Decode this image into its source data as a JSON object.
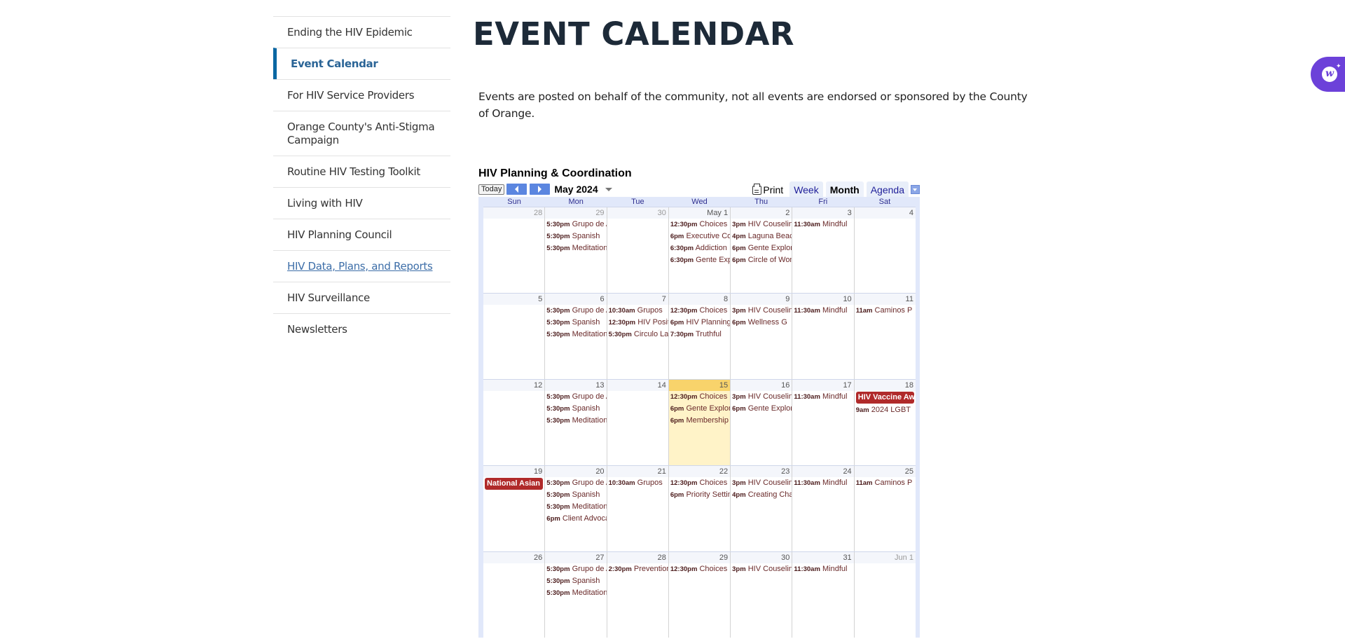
{
  "sidebar": {
    "items": [
      {
        "label": "Ending the HIV Epidemic",
        "state": "normal"
      },
      {
        "label": "Event Calendar",
        "state": "active"
      },
      {
        "label": "For HIV Service Providers",
        "state": "normal"
      },
      {
        "label": "Orange County's Anti-Stigma Campaign",
        "state": "normal"
      },
      {
        "label": "Routine HIV Testing Toolkit",
        "state": "normal"
      },
      {
        "label": "Living with HIV",
        "state": "normal"
      },
      {
        "label": "HIV Planning Council",
        "state": "normal"
      },
      {
        "label": "HIV Data, Plans, and Reports",
        "state": "link"
      },
      {
        "label": "HIV Surveillance",
        "state": "normal"
      },
      {
        "label": "Newsletters",
        "state": "normal"
      }
    ],
    "active_color": "#0a67a3"
  },
  "page": {
    "title": "EVENT CALENDAR",
    "intro": "Events are posted on behalf of the community, not all events are endorsed or sponsored by the County of Orange."
  },
  "calendar": {
    "title": "HIV Planning & Coordination",
    "today_label": "Today",
    "prev_icon": "prev-arrow-icon",
    "next_icon": "next-arrow-icon",
    "month_label": "May 2024",
    "print_label": "Print",
    "views": [
      {
        "label": "Week",
        "active": false
      },
      {
        "label": "Month",
        "active": true
      },
      {
        "label": "Agenda",
        "active": false
      }
    ],
    "weekdays": [
      "Sun",
      "Mon",
      "Tue",
      "Wed",
      "Thu",
      "Fri",
      "Sat"
    ],
    "today_color": "#f8d36b",
    "allday_color": "#b02a2a",
    "weeks": [
      [
        {
          "num": "28",
          "other": true,
          "events": []
        },
        {
          "num": "29",
          "other": true,
          "events": [
            {
              "time": "5:30pm",
              "name": "Grupo de Apoyo"
            },
            {
              "time": "5:30pm",
              "name": " Spanish"
            },
            {
              "time": "5:30pm",
              "name": "Meditation"
            }
          ]
        },
        {
          "num": "30",
          "other": true,
          "events": []
        },
        {
          "num": "May 1",
          "events": [
            {
              "time": "12:30pm",
              "name": "Choices"
            },
            {
              "time": "6pm",
              "name": "Executive Committee"
            },
            {
              "time": "6:30pm",
              "name": "Addiction"
            },
            {
              "time": "6:30pm",
              "name": "Gente Explorando"
            }
          ]
        },
        {
          "num": "2",
          "events": [
            {
              "time": "3pm",
              "name": "HIV Couseling"
            },
            {
              "time": "4pm",
              "name": "Laguna Beach"
            },
            {
              "time": "6pm",
              "name": "Gente Explorando"
            },
            {
              "time": "6pm",
              "name": "Circle of Women"
            }
          ]
        },
        {
          "num": "3",
          "events": [
            {
              "time": "11:30am",
              "name": "Mindful"
            }
          ]
        },
        {
          "num": "4",
          "events": []
        }
      ],
      [
        {
          "num": "5",
          "events": []
        },
        {
          "num": "6",
          "events": [
            {
              "time": "5:30pm",
              "name": "Grupo de Apoyo"
            },
            {
              "time": "5:30pm",
              "name": " Spanish"
            },
            {
              "time": "5:30pm",
              "name": "Meditation"
            }
          ]
        },
        {
          "num": "7",
          "events": [
            {
              "time": "10:30am",
              "name": "Grupos"
            },
            {
              "time": "12:30pm",
              "name": "HIV Positive"
            },
            {
              "time": "5:30pm",
              "name": "Circulo Latino"
            }
          ]
        },
        {
          "num": "8",
          "events": [
            {
              "time": "12:30pm",
              "name": "Choices"
            },
            {
              "time": "6pm",
              "name": "HIV Planning"
            },
            {
              "time": "7:30pm",
              "name": "Truthful"
            }
          ]
        },
        {
          "num": "9",
          "events": [
            {
              "time": "3pm",
              "name": "HIV Couseling"
            },
            {
              "time": "6pm",
              "name": "Wellness G"
            }
          ]
        },
        {
          "num": "10",
          "events": [
            {
              "time": "11:30am",
              "name": "Mindful"
            }
          ]
        },
        {
          "num": "11",
          "events": [
            {
              "time": "11am",
              "name": "Caminos P"
            }
          ]
        }
      ],
      [
        {
          "num": "12",
          "events": []
        },
        {
          "num": "13",
          "events": [
            {
              "time": "5:30pm",
              "name": "Grupo de Apoyo"
            },
            {
              "time": "5:30pm",
              "name": " Spanish"
            },
            {
              "time": "5:30pm",
              "name": "Meditation"
            }
          ]
        },
        {
          "num": "14",
          "events": []
        },
        {
          "num": "15",
          "today": true,
          "events": [
            {
              "time": "12:30pm",
              "name": "Choices"
            },
            {
              "time": "6pm",
              "name": "Gente Explorando"
            },
            {
              "time": "6pm",
              "name": "Membership"
            }
          ]
        },
        {
          "num": "16",
          "events": [
            {
              "time": "3pm",
              "name": "HIV Couseling"
            },
            {
              "time": "6pm",
              "name": "Gente Explorando"
            }
          ]
        },
        {
          "num": "17",
          "events": [
            {
              "time": "11:30am",
              "name": "Mindful"
            }
          ]
        },
        {
          "num": "18",
          "events": [
            {
              "allday": true,
              "name": "HIV Vaccine Awareness"
            },
            {
              "time": "9am",
              "name": "2024 LGBT"
            }
          ]
        }
      ],
      [
        {
          "num": "19",
          "events": [
            {
              "allday": true,
              "name": "National Asian"
            }
          ]
        },
        {
          "num": "20",
          "events": [
            {
              "time": "5:30pm",
              "name": "Grupo de Apoyo"
            },
            {
              "time": "5:30pm",
              "name": " Spanish"
            },
            {
              "time": "5:30pm",
              "name": "Meditation"
            },
            {
              "time": "6pm",
              "name": "Client Advocacy"
            }
          ]
        },
        {
          "num": "21",
          "events": [
            {
              "time": "10:30am",
              "name": "Grupos"
            }
          ]
        },
        {
          "num": "22",
          "events": [
            {
              "time": "12:30pm",
              "name": "Choices"
            },
            {
              "time": "6pm",
              "name": "Priority Setting"
            }
          ]
        },
        {
          "num": "23",
          "events": [
            {
              "time": "3pm",
              "name": "HIV Couseling"
            },
            {
              "time": "4pm",
              "name": "Creating Change"
            }
          ]
        },
        {
          "num": "24",
          "events": [
            {
              "time": "11:30am",
              "name": "Mindful"
            }
          ]
        },
        {
          "num": "25",
          "events": [
            {
              "time": "11am",
              "name": "Caminos P"
            }
          ]
        }
      ],
      [
        {
          "num": "26",
          "events": []
        },
        {
          "num": "27",
          "events": [
            {
              "time": "5:30pm",
              "name": "Grupo de Apoyo"
            },
            {
              "time": "5:30pm",
              "name": " Spanish"
            },
            {
              "time": "5:30pm",
              "name": "Meditation"
            }
          ]
        },
        {
          "num": "28",
          "events": [
            {
              "time": "2:30pm",
              "name": "Prevention"
            }
          ]
        },
        {
          "num": "29",
          "events": [
            {
              "time": "12:30pm",
              "name": "Choices"
            }
          ]
        },
        {
          "num": "30",
          "events": [
            {
              "time": "3pm",
              "name": "HIV Couseling"
            }
          ]
        },
        {
          "num": "31",
          "events": [
            {
              "time": "11:30am",
              "name": "Mindful"
            }
          ]
        },
        {
          "num": "Jun 1",
          "other": true,
          "events": []
        }
      ]
    ]
  },
  "widget": {
    "icon": "accessibility-widget-icon",
    "color": "#6c41d9"
  }
}
